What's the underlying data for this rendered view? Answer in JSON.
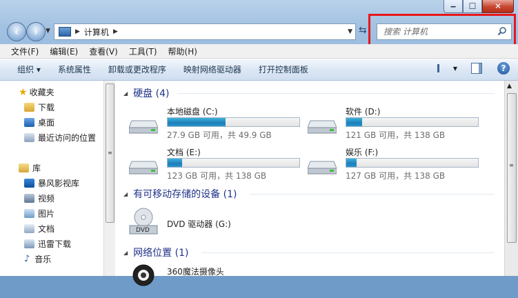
{
  "window": {
    "min": "‒",
    "max": "☐",
    "close": "✕"
  },
  "address": {
    "crumb": "计算机"
  },
  "search": {
    "placeholder": "搜索 计算机"
  },
  "menu": [
    "文件(F)",
    "编辑(E)",
    "查看(V)",
    "工具(T)",
    "帮助(H)"
  ],
  "toolbar": {
    "organize": "组织 ▾",
    "system_props": "系统属性",
    "uninstall": "卸载或更改程序",
    "map_drive": "映射网络驱动器",
    "control_panel": "打开控制面板"
  },
  "nav": {
    "favorites": "收藏夹",
    "downloads": "下载",
    "desktop": "桌面",
    "recent": "最近访问的位置",
    "libraries": "库",
    "storm": "暴风影视库",
    "videos": "视频",
    "pictures": "图片",
    "documents": "文档",
    "thunder": "迅雷下载",
    "music": "音乐"
  },
  "groups": {
    "hdd": "硬盘 (4)",
    "removable": "有可移动存储的设备 (1)",
    "network": "网络位置 (1)"
  },
  "drives": [
    {
      "name": "本地磁盘 (C:)",
      "info": "27.9 GB 可用，共 49.9 GB",
      "used_fraction": 0.44
    },
    {
      "name": "软件 (D:)",
      "info": "121 GB 可用，共 138 GB",
      "used_fraction": 0.12
    },
    {
      "name": "文档 (E:)",
      "info": "123 GB 可用，共 138 GB",
      "used_fraction": 0.11
    },
    {
      "name": "娱乐 (F:)",
      "info": "127 GB 可用，共 138 GB",
      "used_fraction": 0.08
    }
  ],
  "dvd": {
    "name": "DVD 驱动器 (G:)",
    "label": "DVD"
  },
  "network_item": {
    "name": "360魔法摄像头"
  },
  "colors": {
    "accent_red": "#e8161b",
    "group_header": "#1e3287",
    "drive_fill": "#1d7fba"
  }
}
